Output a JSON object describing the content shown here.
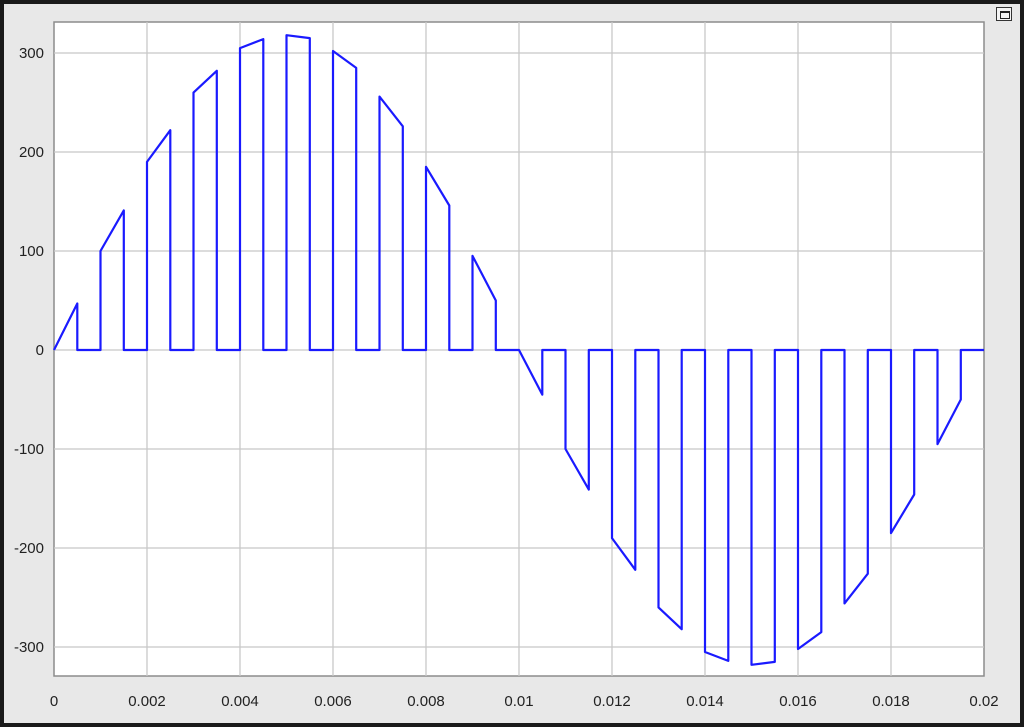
{
  "chart_data": {
    "type": "line",
    "title": "",
    "xlabel": "",
    "ylabel": "",
    "xlim": [
      0,
      0.02
    ],
    "ylim": [
      -330,
      330
    ],
    "grid": true,
    "legend": "none",
    "line_color": "#1a1aff",
    "background": "#ffffff",
    "x_ticks": [
      0,
      0.002,
      0.004,
      0.006,
      0.008,
      0.01,
      0.012,
      0.014,
      0.016,
      0.018,
      0.02
    ],
    "x_tick_labels": [
      "0",
      "0.002",
      "0.004",
      "0.006",
      "0.008",
      "0.01",
      "0.012",
      "0.014",
      "0.016",
      "0.018",
      "0.02"
    ],
    "y_ticks": [
      300,
      200,
      100,
      0,
      -100,
      -200,
      -300
    ],
    "y_tick_labels": [
      "300",
      "200",
      "100",
      "0",
      "-100",
      "-200",
      "-300"
    ],
    "series": [
      {
        "x": [
          0,
          0.0005,
          0.0005,
          0.001,
          0.001,
          0.0015,
          0.0015,
          0.002,
          0.002,
          0.0025,
          0.0025,
          0.003,
          0.003,
          0.0035,
          0.0035,
          0.004,
          0.004,
          0.0045,
          0.0045,
          0.005,
          0.005,
          0.0055,
          0.0055,
          0.006,
          0.006,
          0.0065,
          0.0065,
          0.007,
          0.007,
          0.0075,
          0.0075,
          0.008,
          0.008,
          0.0085,
          0.0085,
          0.009,
          0.009,
          0.0095,
          0.0095,
          0.01,
          0.0105,
          0.0105,
          0.011,
          0.011,
          0.0115,
          0.0115,
          0.012,
          0.012,
          0.0125,
          0.0125,
          0.013,
          0.013,
          0.0135,
          0.0135,
          0.014,
          0.014,
          0.0145,
          0.0145,
          0.015,
          0.015,
          0.0155,
          0.0155,
          0.016,
          0.016,
          0.0165,
          0.0165,
          0.017,
          0.017,
          0.0175,
          0.0175,
          0.018,
          0.018,
          0.0185,
          0.0185,
          0.019,
          0.019,
          0.0195,
          0.0195,
          0.02
        ],
        "y": [
          0,
          47,
          0,
          0,
          100,
          141,
          0,
          0,
          190,
          222,
          0,
          0,
          260,
          282,
          0,
          0,
          305,
          314,
          0,
          0,
          318,
          315,
          0,
          0,
          302,
          285,
          0,
          0,
          256,
          226,
          0,
          0,
          185,
          146,
          0,
          0,
          95,
          50,
          0,
          0,
          -45,
          0,
          0,
          -100,
          -141,
          0,
          0,
          -190,
          -222,
          0,
          0,
          -260,
          -282,
          0,
          0,
          -305,
          -314,
          0,
          0,
          -318,
          -315,
          0,
          0,
          -302,
          -285,
          0,
          0,
          -256,
          -226,
          0,
          0,
          -185,
          -146,
          0,
          0,
          -95,
          -50,
          0,
          0
        ]
      }
    ]
  }
}
